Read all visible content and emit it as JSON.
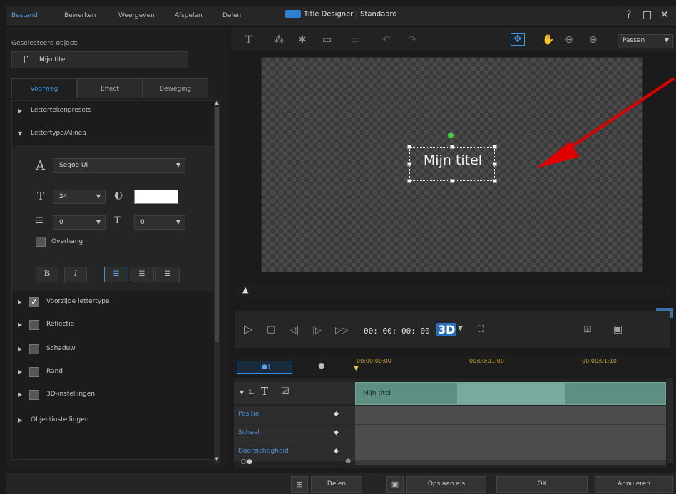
{
  "menu": {
    "items": [
      "Bestand",
      "Bewerken",
      "Weergeven",
      "Afspelen",
      "Delen"
    ],
    "active_index": 0
  },
  "window": {
    "title": "Title Designer | Standaard",
    "help": "?",
    "maximize": "□",
    "close": "✕"
  },
  "left": {
    "selected_label": "Geselecteerd object:",
    "selected_value": "Mijn titel",
    "tabs": [
      "Voorweg",
      "Effect",
      "Beweging"
    ],
    "active_tab": 0,
    "sections": {
      "presets": "Lettertekenpresets",
      "font": "Lettertype/Alinea",
      "fill": "Voorzijde lettertype",
      "reflection": "Reflectie",
      "shadow": "Schaduw",
      "border": "Rand",
      "settings3d": "3D-instellingen",
      "object": "Objectinstellingen"
    },
    "font_name": "Segoe UI",
    "font_size": "24",
    "font_color": "#ffffff",
    "line_spacing": "0",
    "char_spacing": "0",
    "overhang": "Overhang",
    "bold": "B",
    "italic": "I"
  },
  "toolbar": {
    "fit": "Passen"
  },
  "canvas": {
    "title_text": "Mijn titel"
  },
  "player": {
    "timecode": "00: 00: 00: 00",
    "badge": "3D"
  },
  "timeline": {
    "tab_label": "[●]",
    "timecodes": [
      "00:00:00:00",
      "00:00:01:00",
      "00:00:01:10"
    ],
    "track_title": "1.",
    "clip_label": "Mijn titel",
    "rows": [
      "Positie",
      "Schaal",
      "Doorzichtigheid"
    ]
  },
  "footer": {
    "share": "Delen",
    "save_as": "Opslaan als",
    "ok": "OK",
    "cancel": "Annuleren"
  }
}
